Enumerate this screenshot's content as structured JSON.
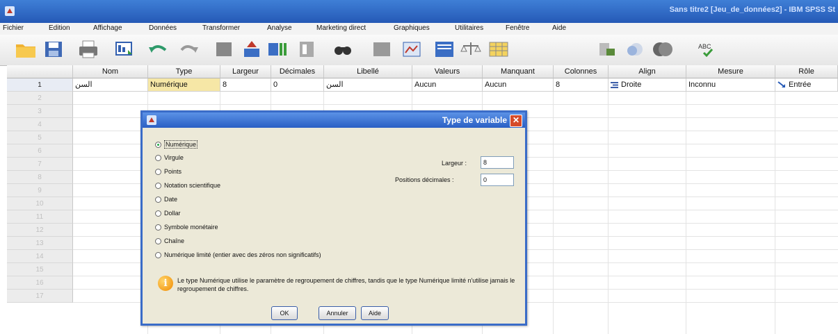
{
  "window": {
    "title": "Sans titre2 [Jeu_de_données2] - IBM SPSS St"
  },
  "menu": [
    "Fichier",
    "Edition",
    "Affichage",
    "Données",
    "Transformer",
    "Analyse",
    "Marketing direct",
    "Graphiques",
    "Utilitaires",
    "Fenêtre",
    "Aide"
  ],
  "toolbar": [
    "open-folder-icon",
    "save-icon",
    "print-icon",
    "dialog-recall-icon",
    "undo-icon",
    "redo-icon",
    "goto-case-icon",
    "goto-variable-icon",
    "variables-icon",
    "find-icon",
    "insert-cases-icon",
    "insert-variable-icon",
    "split-file-icon",
    "weight-cases-icon",
    "select-cases-icon",
    "value-labels-icon",
    "use-sets-icon",
    "show-all-variables-icon",
    "spell-check-icon"
  ],
  "grid": {
    "columns": [
      "Nom",
      "Type",
      "Largeur",
      "Décimales",
      "Libellé",
      "Valeurs",
      "Manquant",
      "Colonnes",
      "Align",
      "Mesure",
      "Rôle"
    ],
    "rows": [
      {
        "num": "1",
        "cells": [
          "السن",
          "Numérique",
          "8",
          "0",
          "السن",
          "Aucun",
          "Aucun",
          "8",
          "Droite",
          "Inconnu",
          "Entrée"
        ]
      }
    ],
    "empty_rows": [
      "2",
      "3",
      "4",
      "5",
      "6",
      "7",
      "8",
      "9",
      "10",
      "11",
      "12",
      "13",
      "14",
      "15",
      "16",
      "17"
    ]
  },
  "dialog": {
    "title": "Type de variable",
    "options": [
      "Numérique",
      "Virgule",
      "Points",
      "Notation scientifique",
      "Date",
      "Dollar",
      "Symbole monétaire",
      "Chaîne",
      "Numérique limité (entier avec des zéros non significatifs)"
    ],
    "selected": "Numérique",
    "width_label": "Largeur :",
    "width_value": "8",
    "decimals_label": "Positions décimales :",
    "decimals_value": "0",
    "info": "Le type Numérique utilise le paramètre de regroupement de chiffres, tandis que le type Numérique limité n'utilise jamais le regroupement de chiffres.",
    "buttons": {
      "ok": "OK",
      "cancel": "Annuler",
      "help": "Aide"
    }
  }
}
